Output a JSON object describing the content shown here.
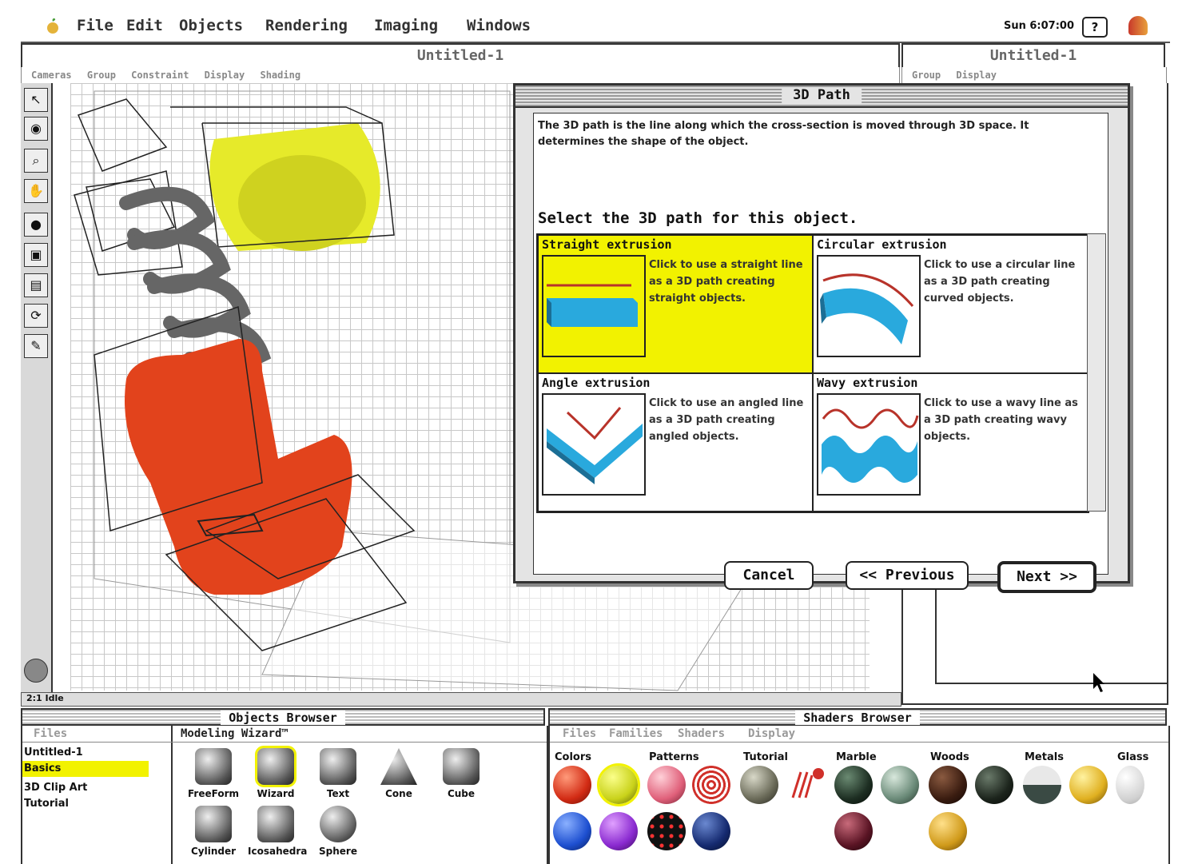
{
  "menubar": {
    "items": [
      "File",
      "Edit",
      "Objects",
      "Rendering",
      "Imaging",
      "Windows"
    ],
    "clock": "Sun 6:07:00",
    "help": "?"
  },
  "main_window": {
    "title": "Untitled-1",
    "menu": [
      "Cameras",
      "Group",
      "Constraint",
      "Display",
      "Shading"
    ],
    "status": "2:1 Idle"
  },
  "side_window": {
    "title": "Untitled-1",
    "menu": [
      "Group",
      "Display"
    ]
  },
  "dialog": {
    "title": "3D Path",
    "description": "The 3D path is the line along which the cross-section is moved through 3D space.  It determines the shape of the object.",
    "prompt": "Select the 3D path for this object.",
    "options": [
      {
        "title": "Straight extrusion",
        "text": "Click to use a straight line as a 3D path creating straight objects.",
        "selected": true
      },
      {
        "title": "Circular extrusion",
        "text": "Click to use a circular line as a 3D path creating curved objects.",
        "selected": false
      },
      {
        "title": "Angle extrusion",
        "text": "Click to use an angled line as a 3D path creating angled objects.",
        "selected": false
      },
      {
        "title": "Wavy extrusion",
        "text": "Click to use a wavy line as a 3D path creating wavy objects.",
        "selected": false
      }
    ],
    "buttons": {
      "cancel": "Cancel",
      "previous": "<< Previous",
      "next": "Next >>"
    }
  },
  "objects_browser": {
    "title": "Objects Browser",
    "tab_files": "Files",
    "tab_wizard": "Modeling Wizard™",
    "files": [
      "Untitled-1",
      "Basics",
      "3D Clip Art",
      "Tutorial"
    ],
    "objects": [
      "FreeForm",
      "Wizard",
      "Text",
      "Cone",
      "Cube",
      "Cylinder",
      "Icosahedra",
      "Sphere"
    ]
  },
  "shaders_browser": {
    "title": "Shaders Browser",
    "tabs": [
      "Files",
      "Families",
      "Shaders",
      "Display"
    ],
    "columns": [
      "Colors",
      "Patterns",
      "Tutorial",
      "Marble",
      "Woods",
      "Metals",
      "Glass"
    ]
  },
  "colors": {
    "highlight": "#f2f200",
    "chair": "#e2431c",
    "cylinder": "#e6ea2a",
    "extrusion": "#29a9dd",
    "path": "#b8332a"
  }
}
